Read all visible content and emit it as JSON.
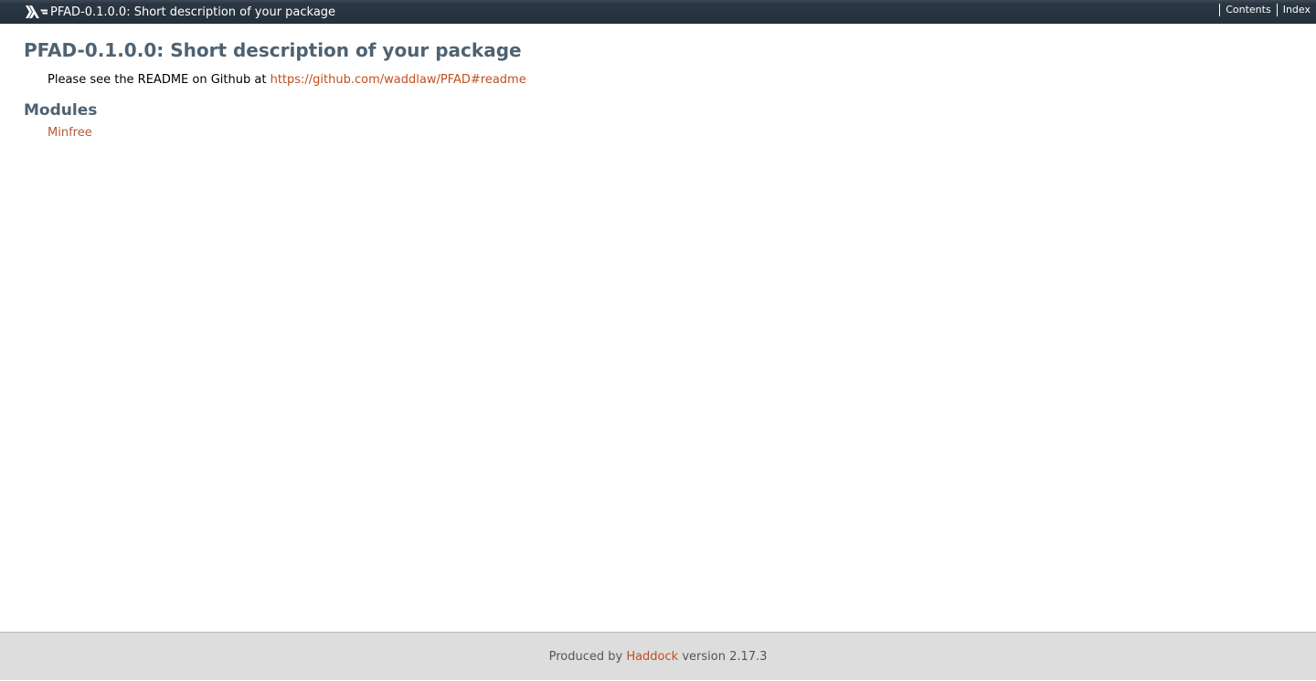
{
  "topbar": {
    "logo_icon": "haskell-logo-icon",
    "caption": "PFAD-0.1.0.0: Short description of your package",
    "links": [
      "Contents",
      "Index"
    ]
  },
  "content": {
    "title": "PFAD-0.1.0.0: Short description of your package",
    "description_prefix": "Please see the README on Github at ",
    "description_link": "https://github.com/waddlaw/PFAD#readme",
    "modules_heading": "Modules",
    "modules": [
      "Minfree"
    ]
  },
  "footer": {
    "prefix": "Produced by ",
    "link": "Haddock",
    "suffix": " version 2.17.3"
  },
  "colors": {
    "topbar_bg": "#24303b",
    "heading": "#4e6272",
    "link": "#c0501f",
    "footer_bg": "#dddddd"
  }
}
